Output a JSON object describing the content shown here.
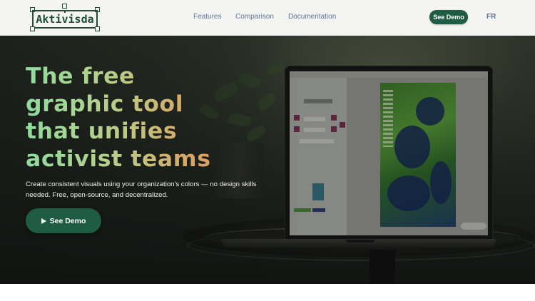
{
  "nav": {
    "logo_text": "Aktivisda",
    "links": [
      {
        "label": "Features"
      },
      {
        "label": "Comparison"
      },
      {
        "label": "Documentation"
      }
    ],
    "demo_label": "See Demo",
    "language_label": "FR"
  },
  "hero": {
    "headline_lines": [
      "The free",
      "graphic tool",
      "that unifies",
      "activist teams"
    ],
    "subtitle": "Create consistent visuals using your organization's colors — no design skills needed. Free, open-source, and decentralized.",
    "cta_label": "See Demo",
    "cta_icon": "play-icon"
  },
  "colors": {
    "brand_green": "#1f5c45",
    "logo_green": "#1f4d3c",
    "nav_link": "#5b7491",
    "headline_gradient": [
      "#8fdc9e",
      "#e49562"
    ]
  }
}
